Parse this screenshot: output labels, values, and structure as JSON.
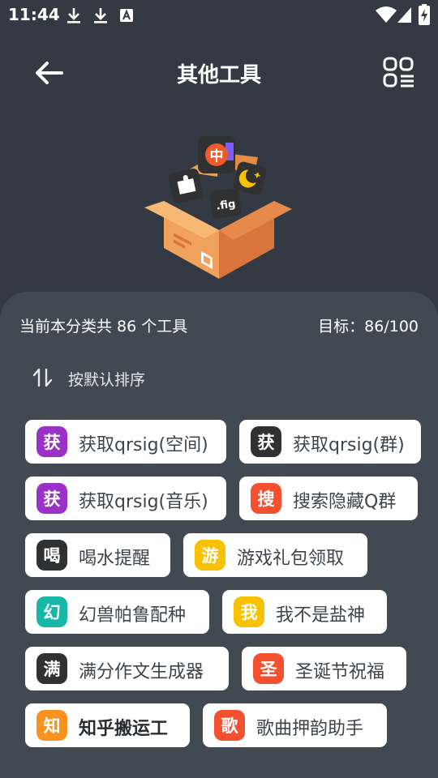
{
  "status_bar": {
    "time": "11:44"
  },
  "app_bar": {
    "title": "其他工具"
  },
  "summary": {
    "text": "当前本分类共 86 个工具",
    "target": "目标：86/100"
  },
  "sort": {
    "label": "按默认排序"
  },
  "hero_icons": {
    "zh": "中",
    "fig": ".fig"
  },
  "tools": [
    {
      "badge": "获",
      "label": "获取qrsig(空间)",
      "color": "#9b32c8"
    },
    {
      "badge": "获",
      "label": "获取qrsig(群)",
      "color": "#2f3133"
    },
    {
      "badge": "获",
      "label": "获取qrsig(音乐)",
      "color": "#9b32c8"
    },
    {
      "badge": "搜",
      "label": "搜索隐藏Q群",
      "color": "#f2502e"
    },
    {
      "badge": "喝",
      "label": "喝水提醒",
      "color": "#2f3133"
    },
    {
      "badge": "游",
      "label": "游戏礼包领取",
      "color": "#f8c200"
    },
    {
      "badge": "幻",
      "label": "幻兽帕鲁配种",
      "color": "#17b8a8"
    },
    {
      "badge": "我",
      "label": "我不是盐神",
      "color": "#f8c200"
    },
    {
      "badge": "满",
      "label": "满分作文生成器",
      "color": "#2f3133"
    },
    {
      "badge": "圣",
      "label": "圣诞节祝福",
      "color": "#f2502e"
    },
    {
      "badge": "知",
      "label": "知乎搬运工",
      "color": "#f7931e"
    },
    {
      "badge": "歌",
      "label": "歌曲押韵助手",
      "color": "#f2502e"
    }
  ]
}
